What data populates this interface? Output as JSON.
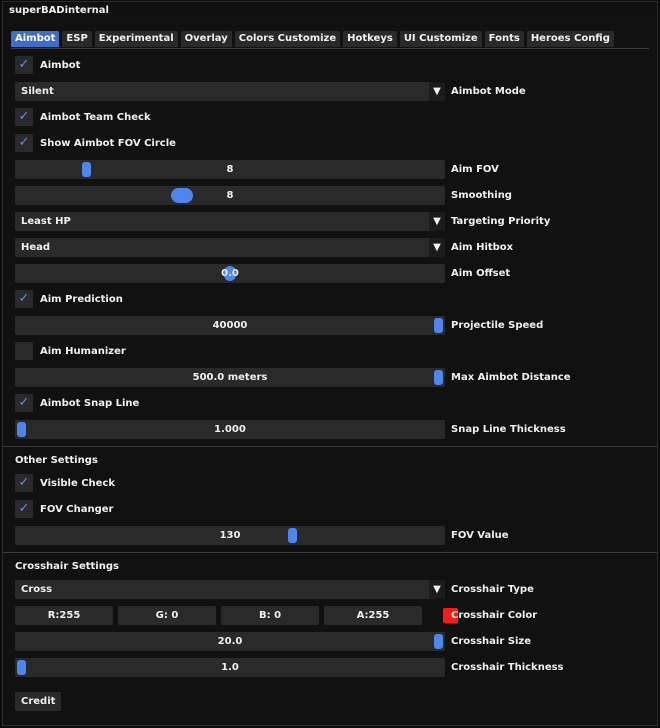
{
  "window": {
    "title": "superBADinternal"
  },
  "tabs": [
    "Aimbot",
    "ESP",
    "Experimental",
    "Overlay",
    "Colors Customize",
    "Hotkeys",
    "UI Customize",
    "Fonts",
    "Heroes Config"
  ],
  "aimbot": {
    "aimbot_cb": {
      "label": "Aimbot",
      "checked": true,
      "glyph": "✓"
    },
    "mode": {
      "value": "Silent",
      "label": "Aimbot Mode"
    },
    "team_check": {
      "label": "Aimbot Team Check",
      "checked": true
    },
    "fov_circle": {
      "label": "Show Aimbot FOV Circle",
      "checked": true
    },
    "aim_fov": {
      "value": "8",
      "label": "Aim FOV",
      "fraction": 0.155
    },
    "smoothing": {
      "value": "8",
      "label": "Smoothing",
      "fraction": 0.38
    },
    "targeting": {
      "value": "Least HP",
      "label": "Targeting Priority"
    },
    "hitbox": {
      "value": "Head",
      "label": "Aim Hitbox"
    },
    "offset": {
      "value": "0.0",
      "label": "Aim Offset",
      "fraction": 0.5
    },
    "prediction": {
      "label": "Aim Prediction",
      "checked": true
    },
    "proj_speed": {
      "value": "40000",
      "label": "Projectile Speed",
      "fraction": 1.0
    },
    "humanizer": {
      "label": "Aim Humanizer",
      "checked": false
    },
    "max_distance": {
      "value": "500.0 meters",
      "label": "Max Aimbot Distance",
      "fraction": 1.0
    },
    "snap_line": {
      "label": "Aimbot Snap Line",
      "checked": true
    },
    "snap_thickness": {
      "value": "1.000",
      "label": "Snap Line Thickness",
      "fraction": 0.0
    }
  },
  "other": {
    "title": "Other Settings",
    "visible_check": {
      "label": "Visible Check",
      "checked": true
    },
    "fov_changer": {
      "label": "FOV Changer",
      "checked": true
    },
    "fov_value": {
      "value": "130",
      "label": "FOV Value",
      "fraction": 0.65
    }
  },
  "crosshair": {
    "title": "Crosshair Settings",
    "type": {
      "value": "Cross",
      "label": "Crosshair Type"
    },
    "color": {
      "r": "R:255",
      "g": "G:  0",
      "b": "B:  0",
      "a": "A:255",
      "label": "Crosshair Color",
      "swatch": "#ff1a1a"
    },
    "size": {
      "value": "20.0",
      "label": "Crosshair Size",
      "fraction": 1.0
    },
    "thickness": {
      "value": "1.0",
      "label": "Crosshair Thickness",
      "fraction": 0.0
    }
  },
  "credit": {
    "label": "Credit"
  },
  "combo_arrow": "▼",
  "accent": "#3d6fc9"
}
